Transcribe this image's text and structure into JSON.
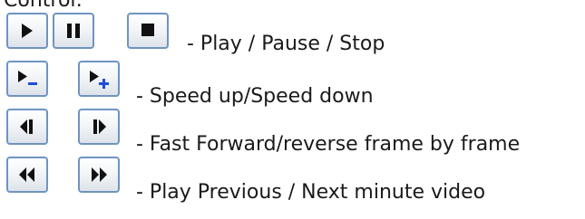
{
  "heading": "Control:",
  "rows": [
    {
      "buttons": [
        "play-icon",
        "pause-icon",
        "stop-icon"
      ],
      "description": "- Play / Pause / Stop"
    },
    {
      "buttons": [
        "speed-down-icon",
        "speed-up-icon"
      ],
      "description": "- Speed up/Speed down"
    },
    {
      "buttons": [
        "frame-reverse-icon",
        "frame-forward-icon"
      ],
      "description": "- Fast Forward/reverse frame by frame"
    },
    {
      "buttons": [
        "previous-minute-icon",
        "next-minute-icon"
      ],
      "description": "- Play Previous / Next minute video"
    }
  ],
  "colors": {
    "button_border": "#6f94bf",
    "glyph": "#111111",
    "minus_sign": "#1e4fd6",
    "plus_sign": "#1e4fd6"
  }
}
